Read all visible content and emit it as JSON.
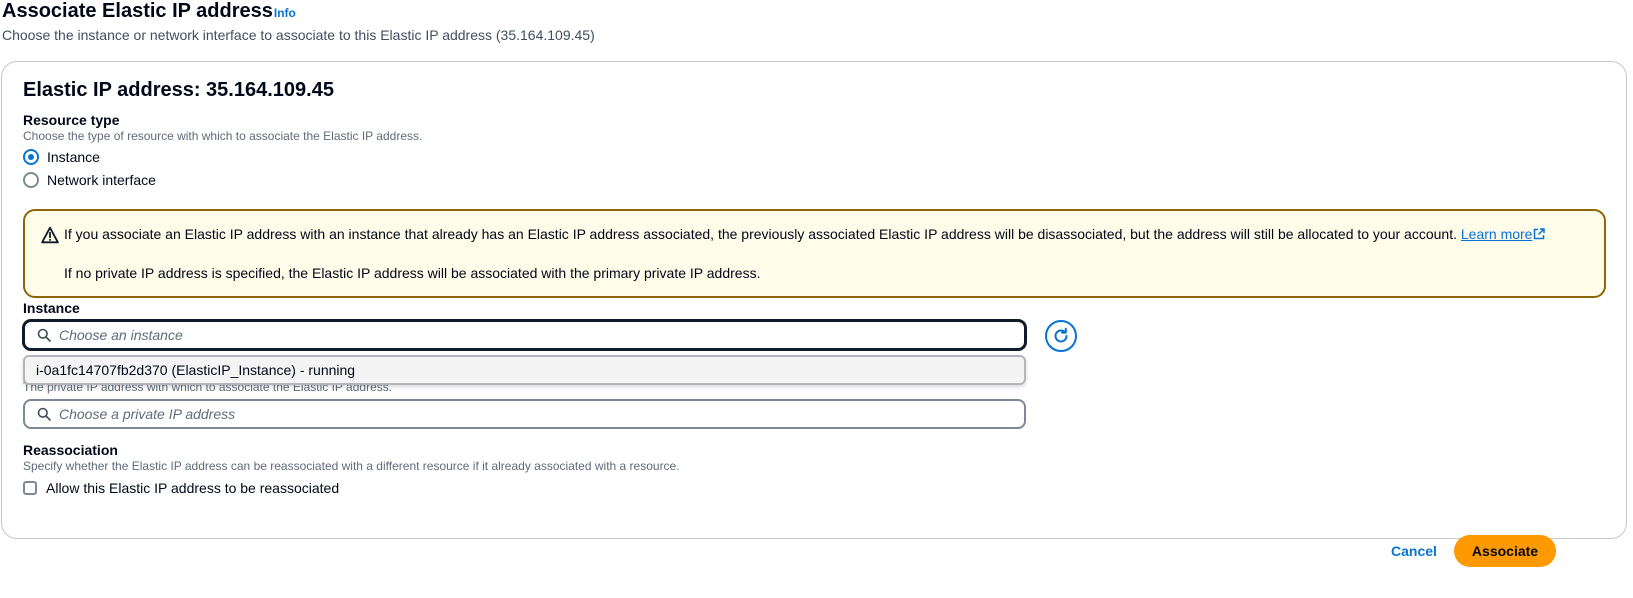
{
  "header": {
    "title": "Associate Elastic IP address",
    "info_link": "Info",
    "subtitle": "Choose the instance or network interface to associate to this Elastic IP address (35.164.109.45)"
  },
  "card": {
    "title": "Elastic IP address: 35.164.109.45"
  },
  "resource_type": {
    "label": "Resource type",
    "description": "Choose the type of resource with which to associate the Elastic IP address.",
    "options": [
      {
        "label": "Instance",
        "selected": true
      },
      {
        "label": "Network interface",
        "selected": false
      }
    ]
  },
  "alert": {
    "line1": "If you associate an Elastic IP address with an instance that already has an Elastic IP address associated, the previously associated Elastic IP address will be disassociated, but the address will still be allocated to your account.",
    "link": "Learn more",
    "line2": "If no private IP address is specified, the Elastic IP address will be associated with the primary private IP address."
  },
  "instance": {
    "label": "Instance",
    "placeholder": "Choose an instance",
    "dropdown_option": "i-0a1fc14707fb2d370 (ElasticIP_Instance) - running"
  },
  "private_ip": {
    "description": "The private IP address with which to associate the Elastic IP address.",
    "placeholder": "Choose a private IP address"
  },
  "reassociation": {
    "label": "Reassociation",
    "description": "Specify whether the Elastic IP address can be reassociated with a different resource if it already associated with a resource.",
    "checkbox_label": "Allow this Elastic IP address to be reassociated"
  },
  "footer": {
    "cancel": "Cancel",
    "associate": "Associate"
  },
  "colors": {
    "link": "#0972d3",
    "primary_button": "#ff9900",
    "warning_border": "#8d6605",
    "warning_bg": "#fffce9"
  }
}
